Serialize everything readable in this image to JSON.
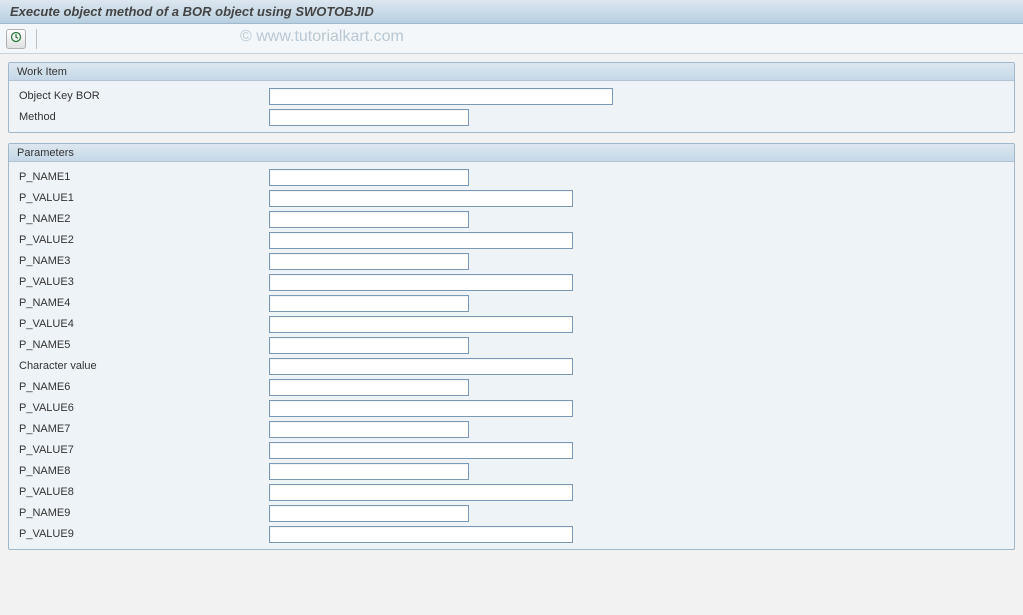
{
  "title": "Execute object method of a BOR object using SWOTOBJID",
  "watermark": "© www.tutorialkart.com",
  "groups": {
    "workItem": {
      "title": "Work Item",
      "fields": {
        "objectKeyBor": {
          "label": "Object Key BOR",
          "value": ""
        },
        "method": {
          "label": "Method",
          "value": ""
        }
      }
    },
    "parameters": {
      "title": "Parameters",
      "fields": {
        "pname1": {
          "label": "P_NAME1",
          "value": ""
        },
        "pvalue1": {
          "label": "P_VALUE1",
          "value": ""
        },
        "pname2": {
          "label": "P_NAME2",
          "value": ""
        },
        "pvalue2": {
          "label": "P_VALUE2",
          "value": ""
        },
        "pname3": {
          "label": "P_NAME3",
          "value": ""
        },
        "pvalue3": {
          "label": "P_VALUE3",
          "value": ""
        },
        "pname4": {
          "label": "P_NAME4",
          "value": ""
        },
        "pvalue4": {
          "label": "P_VALUE4",
          "value": ""
        },
        "pname5": {
          "label": "P_NAME5",
          "value": ""
        },
        "charval": {
          "label": "Character value",
          "value": ""
        },
        "pname6": {
          "label": "P_NAME6",
          "value": ""
        },
        "pvalue6": {
          "label": "P_VALUE6",
          "value": ""
        },
        "pname7": {
          "label": "P_NAME7",
          "value": ""
        },
        "pvalue7": {
          "label": "P_VALUE7",
          "value": ""
        },
        "pname8": {
          "label": "P_NAME8",
          "value": ""
        },
        "pvalue8": {
          "label": "P_VALUE8",
          "value": ""
        },
        "pname9": {
          "label": "P_NAME9",
          "value": ""
        },
        "pvalue9": {
          "label": "P_VALUE9",
          "value": ""
        }
      }
    }
  }
}
